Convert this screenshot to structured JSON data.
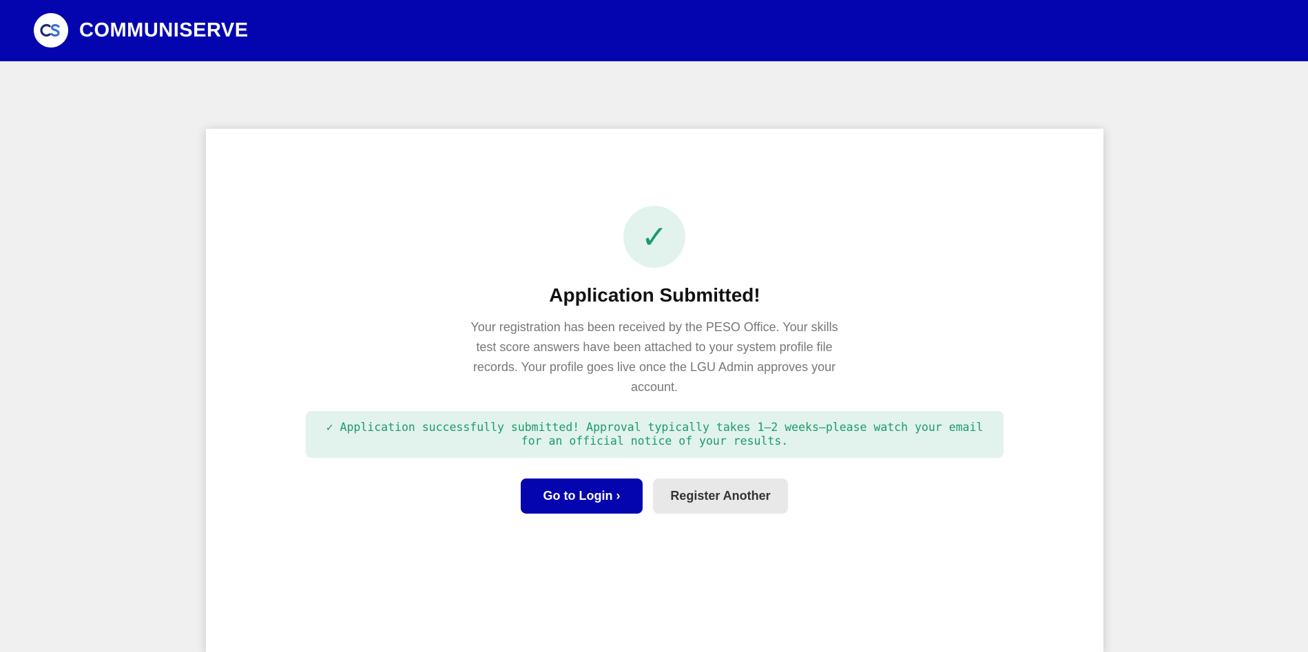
{
  "header": {
    "logo_icon": "cs-monogram-logo",
    "brand_name": "COMMUNISERVE",
    "background_color": "#0505b0"
  },
  "confirmation": {
    "status_icon": "checkmark-icon",
    "check_glyph": "✓",
    "title": "Application Submitted!",
    "description": "Your registration has been received by the PESO Office. Your skills test score answers have been attached to your system profile file records. Your profile goes live once the LGU Admin approves your account.",
    "notice_text": "✓ Application successfully submitted! Approval typically takes 1–2 weeks—please watch your email for an official notice of your results.",
    "accent_color": "#1d9a6c"
  },
  "actions": {
    "login_label": "Go to Login ›",
    "register_another_label": "Register Another"
  }
}
